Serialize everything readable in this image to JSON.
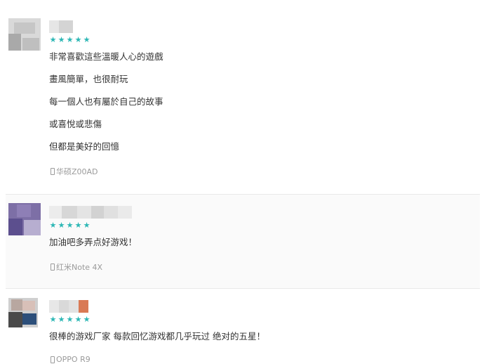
{
  "reviews": [
    {
      "rating": 5,
      "stars": [
        "★",
        "★",
        "★",
        "★",
        "★"
      ],
      "lines": [
        "非常喜歡這些溫暖人心的遊戲",
        "畫風簡單，也很耐玩",
        "每一個人也有屬於自己的故事",
        "或喜悅或悲傷",
        "但都是美好的回憶"
      ],
      "device": "华硕Z00AD"
    },
    {
      "rating": 5,
      "stars": [
        "★",
        "★",
        "★",
        "★",
        "★"
      ],
      "lines": [
        "加油吧多弄点好游戏！"
      ],
      "device": "红米Note 4X"
    },
    {
      "rating": 5,
      "stars": [
        "★",
        "★",
        "★",
        "★",
        "★"
      ],
      "lines": [
        "很棒的游戏厂家 每款回忆游戏都几乎玩过 绝对的五星！"
      ],
      "device": "OPPO R9"
    }
  ],
  "colors": {
    "star": "#2db7b5",
    "device_text": "#9a9a9a",
    "divider": "#e9e9e9"
  },
  "icons": {
    "device": "phone-icon",
    "rating": "star-icon"
  }
}
